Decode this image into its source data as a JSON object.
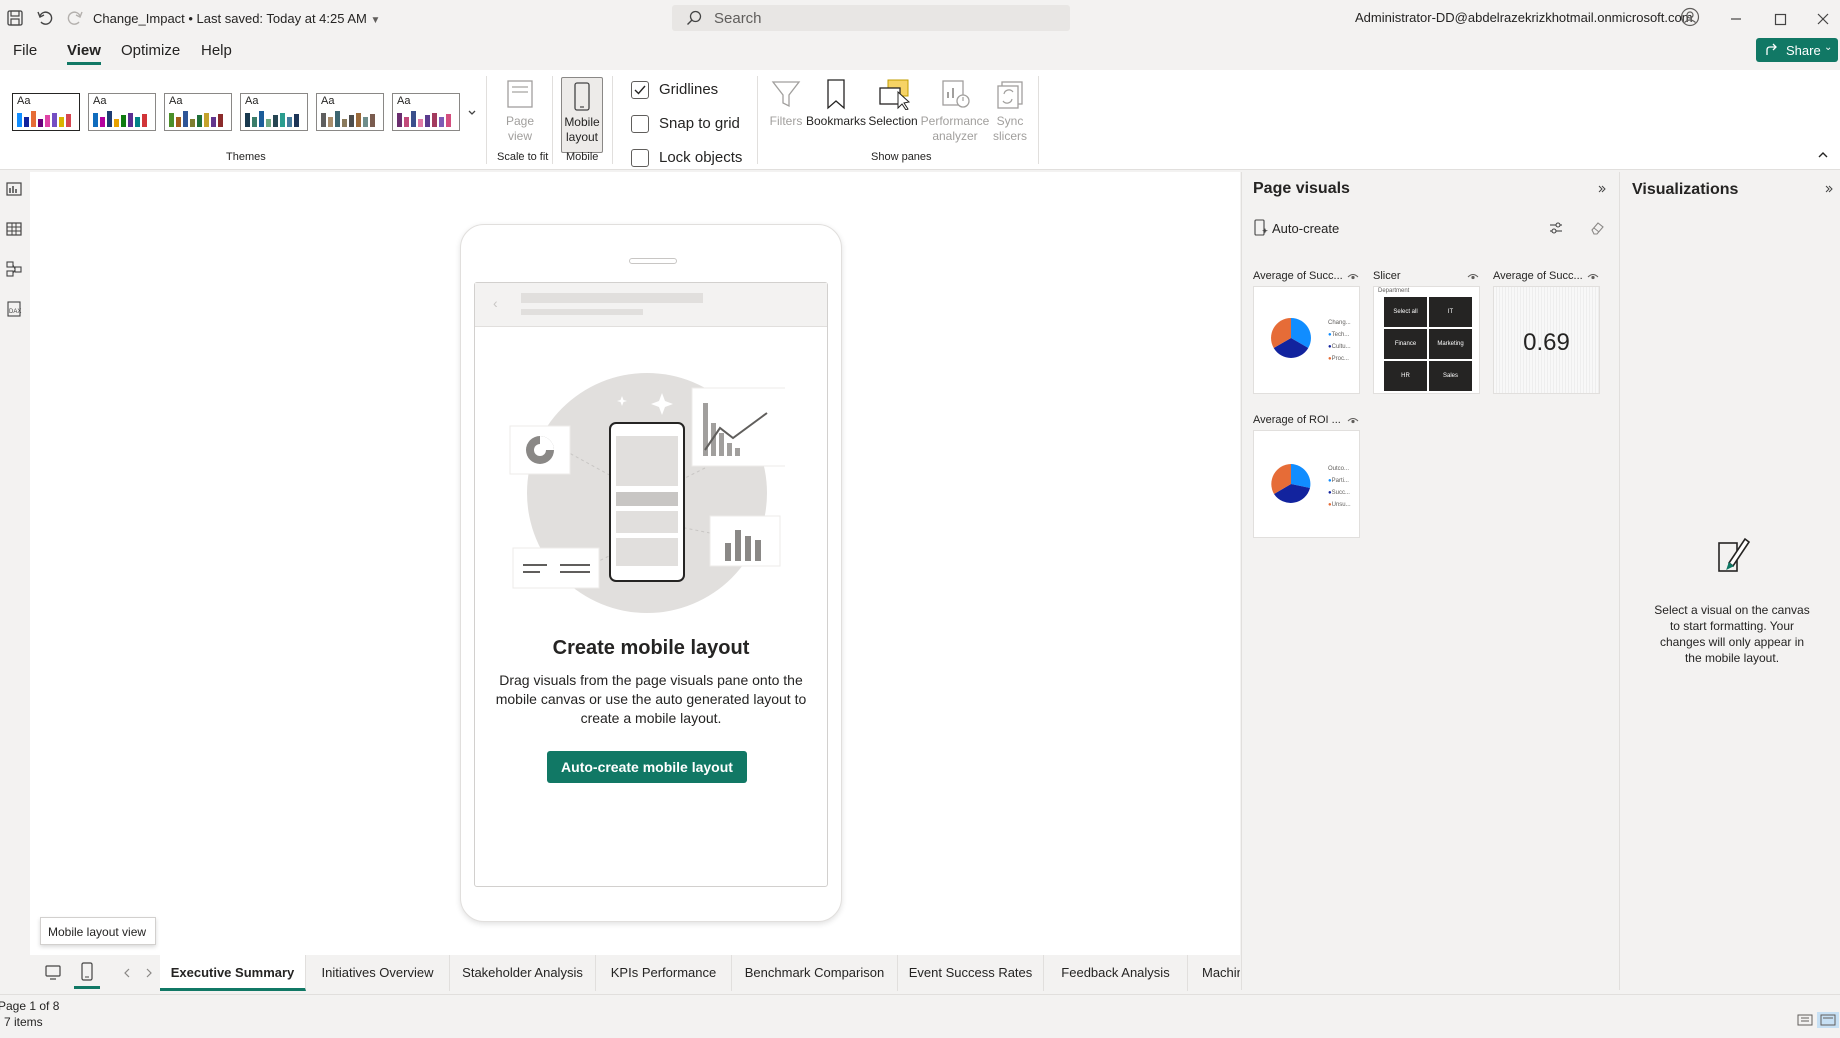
{
  "titlebar": {
    "document_title": "Change_Impact • Last saved: Today at 4:25 AM",
    "search_placeholder": "Search",
    "account": "Administrator-DD@abdelrazekrizkhotmail.onmicrosoft.com"
  },
  "menu": {
    "items": [
      "File",
      "View",
      "Optimize",
      "Help"
    ],
    "active": "View",
    "share_label": "Share"
  },
  "ribbon": {
    "themes_label": "Themes",
    "theme_thumb_text": "Aa",
    "page_view_label": "Page view",
    "scale_to_fit_label": "Scale to fit",
    "mobile_layout_label": "Mobile layout",
    "mobile_label": "Mobile",
    "gridlines_label": "Gridlines",
    "gridlines_checked": true,
    "snap_to_grid_label": "Snap to grid",
    "snap_to_grid_checked": false,
    "lock_objects_label": "Lock objects",
    "lock_objects_checked": false,
    "filters_label": "Filters",
    "bookmarks_label": "Bookmarks",
    "selection_label": "Selection",
    "performance_analyzer_label": "Performance analyzer",
    "sync_slicers_label": "Sync slicers",
    "show_panes_label": "Show panes"
  },
  "canvas": {
    "create_title": "Create mobile layout",
    "create_description": "Drag visuals from the page visuals pane onto the mobile canvas or use the auto generated layout to create a mobile layout.",
    "auto_create_button": "Auto-create mobile layout",
    "tooltip": "Mobile layout view"
  },
  "page_tabs": {
    "tabs": [
      "Executive Summary",
      "Initiatives Overview",
      "Stakeholder Analysis",
      "KPIs Performance",
      "Benchmark Comparison",
      "Event Success Rates",
      "Feedback Analysis",
      "Machin"
    ],
    "active": "Executive Summary"
  },
  "statusbar": {
    "page_count": "Page 1 of 8",
    "items_count": "7 items"
  },
  "page_visuals": {
    "title": "Page visuals",
    "auto_create_label": "Auto-create",
    "visuals": [
      {
        "label": "Average of Succ...",
        "legend_title": "Chang...",
        "legend_items": [
          "Tech...",
          "Cultu...",
          "Proc..."
        ]
      },
      {
        "label": "Slicer",
        "slicer_title": "Department",
        "slicer_items": [
          "Select all",
          "IT",
          "Finance",
          "Marketing",
          "HR",
          "Sales"
        ]
      },
      {
        "label": "Average of Succ...",
        "card_value": "0.69"
      },
      {
        "label": "Average of ROI ...",
        "legend_title": "Outco...",
        "legend_items": [
          "Parti...",
          "Succ...",
          "Unsu..."
        ]
      }
    ]
  },
  "visualizations": {
    "title": "Visualizations",
    "message": "Select a visual on the canvas to start formatting. Your changes will only appear in the mobile layout."
  },
  "colors": {
    "accent": "#117865",
    "pie_blue": "#118dff",
    "pie_navy": "#12239e",
    "pie_orange": "#e66c37"
  }
}
